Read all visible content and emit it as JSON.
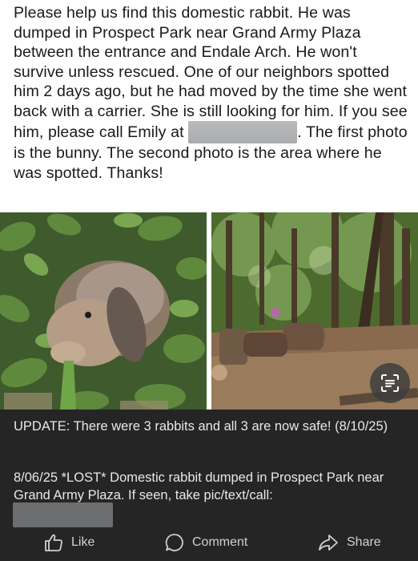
{
  "post": {
    "line1": "Please help us find this domestic rabbit. He was dumped in Prospect Park near Grand Army Plaza between the entrance and Endale Arch. He won't survive unless rescued. One of our neighbors spotted him 2 days ago, but he had moved by the time she went back with a carrier. She is still looking for him. If you see him, please call Emily at",
    "line2": ". The first photo is the bunny. The second photo is the area where he was spotted. Thanks!"
  },
  "photos": [
    {
      "icon": "rabbit-photo"
    },
    {
      "icon": "park-area-photo"
    }
  ],
  "scan_icon": "text-scan-icon",
  "update": {
    "text": "UPDATE:  There were 3 rabbits and all 3 are now safe! (8/10/25)"
  },
  "lost": {
    "text": "8/06/25 *LOST* Domestic rabbit dumped in Prospect Park near Grand Army Plaza. If seen, take pic/text/call:"
  },
  "actions": {
    "like": "Like",
    "comment": "Comment",
    "share": "Share"
  },
  "colors": {
    "panel_bg": "#252526",
    "action_text": "#cfd1d5"
  }
}
